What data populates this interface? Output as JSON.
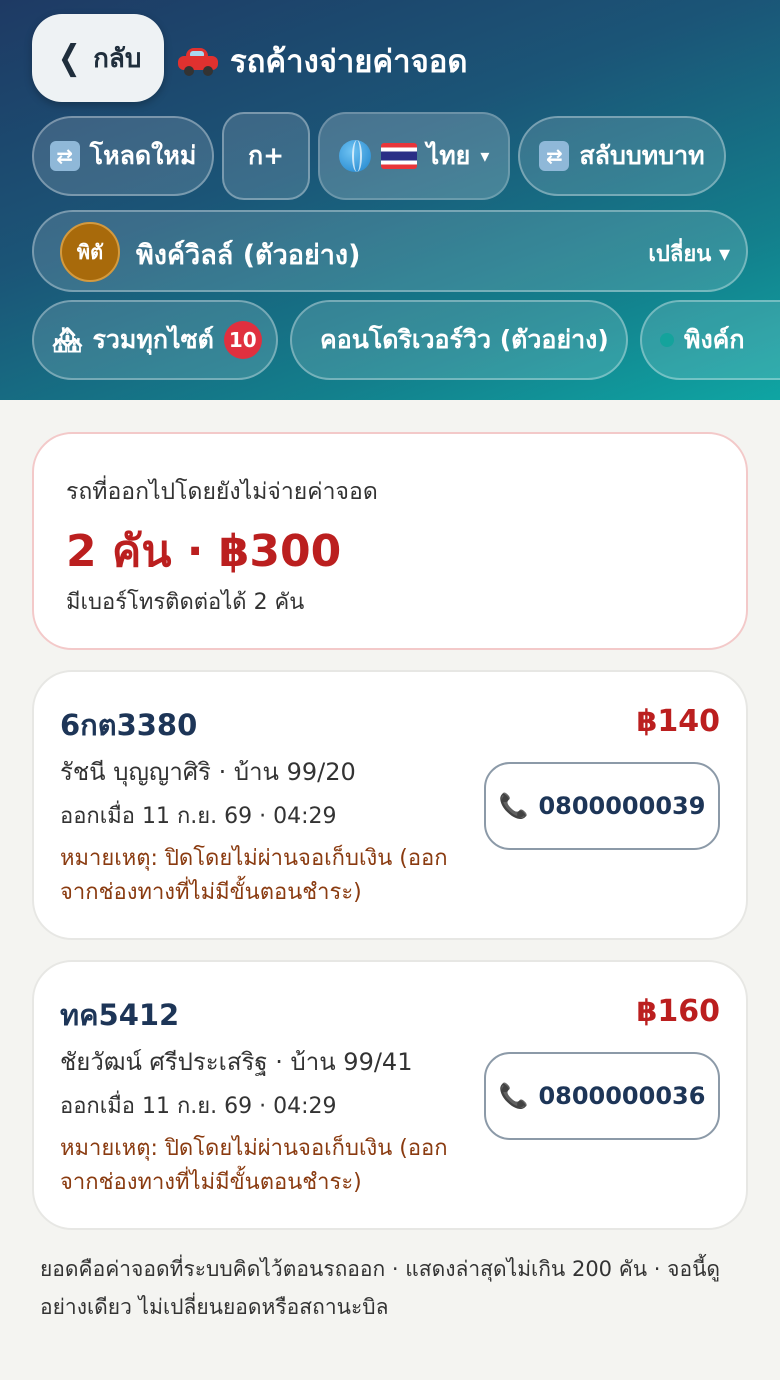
{
  "header": {
    "back_label": "กลับ",
    "title": "รถค้างจ่ายค่าจอด",
    "reload_label": "โหลดใหม่",
    "font_size_label": "ก+",
    "language_label": "ไทย",
    "switch_role_label": "สลับบทบาท"
  },
  "site": {
    "avatar_text": "พิตั",
    "name": "พิงค์วิลล์ (ตัวอย่าง)",
    "change_label": "เปลี่ยน ▾"
  },
  "chips": [
    {
      "label": "รวมทุกไซต์",
      "badge": "10"
    },
    {
      "label": "คอนโดริเวอร์วิว (ตัวอย่าง)",
      "dot_color": "#e8478b"
    },
    {
      "label": "พิงค์ก",
      "dot_color": "#14a39c"
    }
  ],
  "summary": {
    "label": "รถที่ออกไปโดยยังไม่จ่ายค่าจอด",
    "headline": "2 คัน · ฿300",
    "sub": "มีเบอร์โทรติดต่อได้ 2 คัน"
  },
  "cars": [
    {
      "plate": "6กต3380",
      "owner": "รัชนี บุญญาศิริ · บ้าน 99/20",
      "time": "ออกเมื่อ 11 ก.ย. 69 · 04:29",
      "note": "หมายเหตุ: ปิดโดยไม่ผ่านจอเก็บเงิน (ออกจากช่องทางที่ไม่มีขั้นตอนชำระ)",
      "amount": "฿140",
      "phone": "0800000039"
    },
    {
      "plate": "ทค5412",
      "owner": "ชัยวัฒน์ ศรีประเสริฐ · บ้าน 99/41",
      "time": "ออกเมื่อ 11 ก.ย. 69 · 04:29",
      "note": "หมายเหตุ: ปิดโดยไม่ผ่านจอเก็บเงิน (ออกจากช่องทางที่ไม่มีขั้นตอนชำระ)",
      "amount": "฿160",
      "phone": "0800000036"
    }
  ],
  "footer": "ยอดคือค่าจอดที่ระบบคิดไว้ตอนรถออก · แสดงล่าสุดไม่เกิน 200 คัน · จอนี้ดูอย่างเดียว ไม่เปลี่ยนยอดหรือสถานะบิล",
  "colors": {
    "accent_red": "#bb1f1f",
    "header_start": "#1e3a64",
    "header_end": "#0fa5a3"
  }
}
